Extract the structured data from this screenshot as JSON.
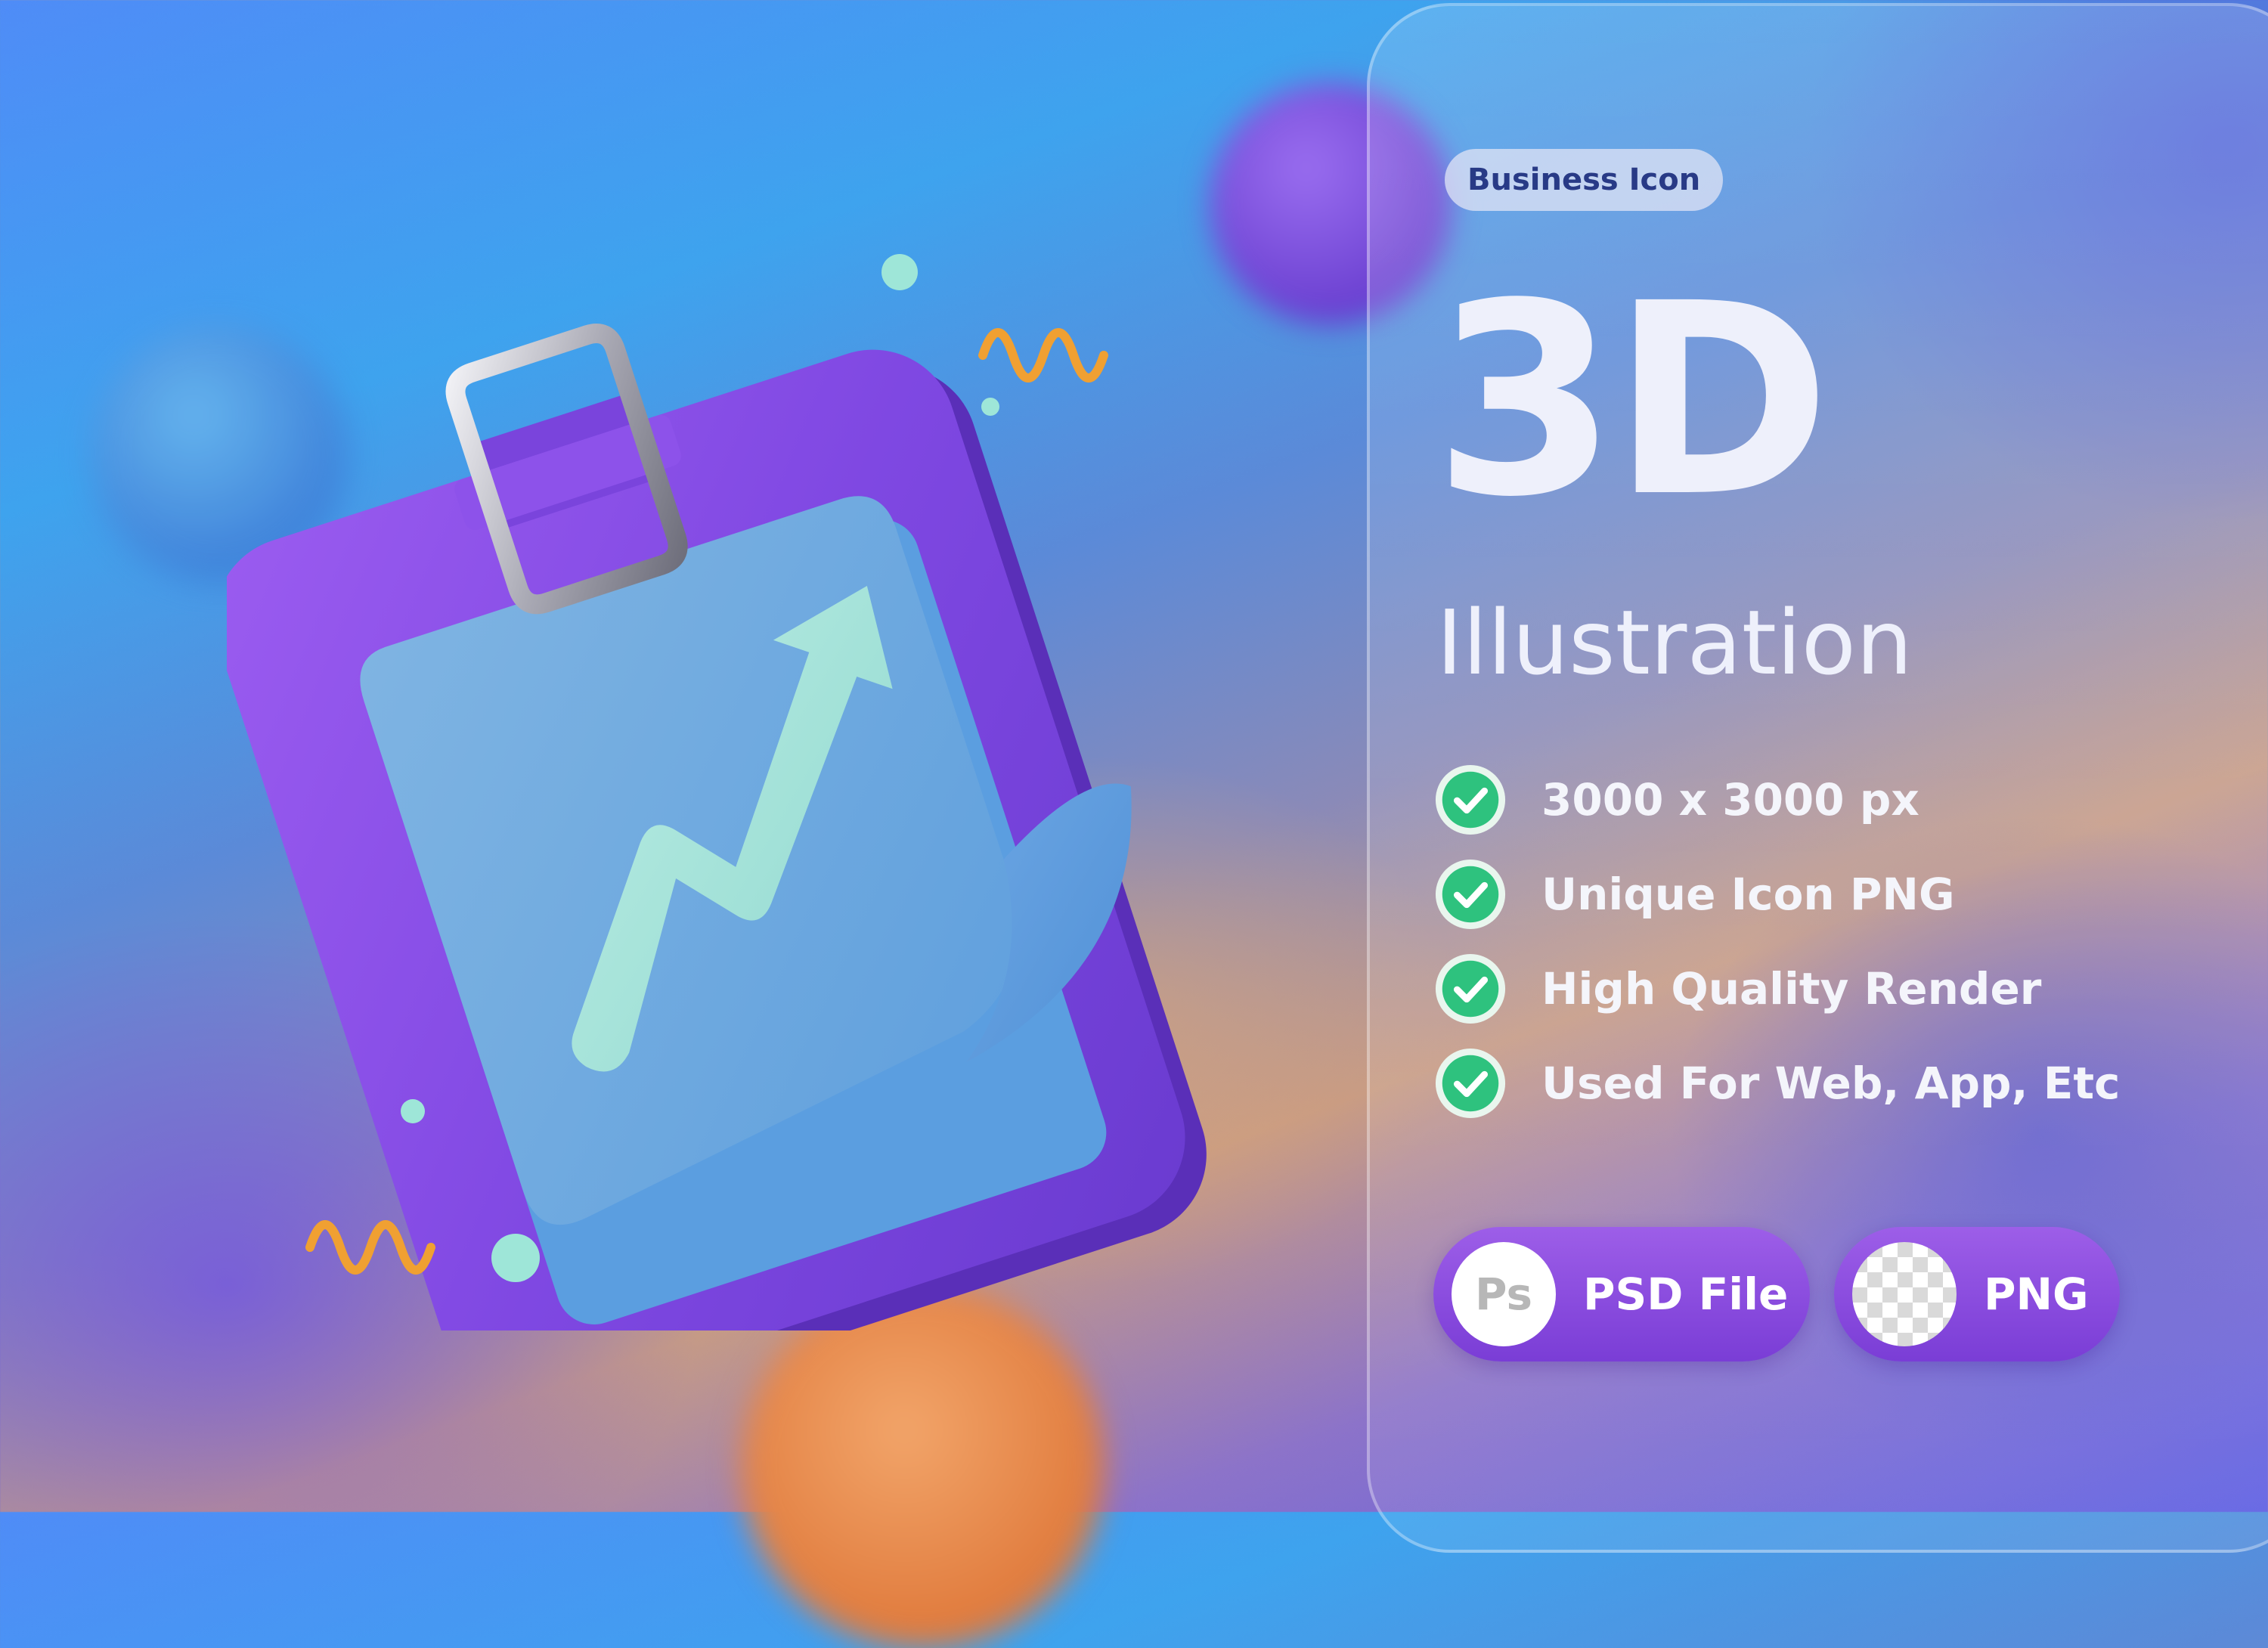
{
  "hero": {
    "badge": "Business Icon",
    "title": "3D",
    "subtitle": "Illustration"
  },
  "features": [
    {
      "text": "3000 x 3000 px",
      "icon": "check-icon"
    },
    {
      "text": "Unique Icon PNG",
      "icon": "check-icon"
    },
    {
      "text": "High Quality Render",
      "icon": "check-icon"
    },
    {
      "text": "Used For Web, App, Etc",
      "icon": "check-icon"
    }
  ],
  "formats": [
    {
      "label": "PSD File",
      "icon_text": "Ps",
      "icon": "photoshop-icon"
    },
    {
      "label": "PNG",
      "icon": "transparency-icon"
    }
  ],
  "colors": {
    "accent_purple": "#8a4de0",
    "check_green": "#2ec27e",
    "badge_text": "#283a86"
  }
}
